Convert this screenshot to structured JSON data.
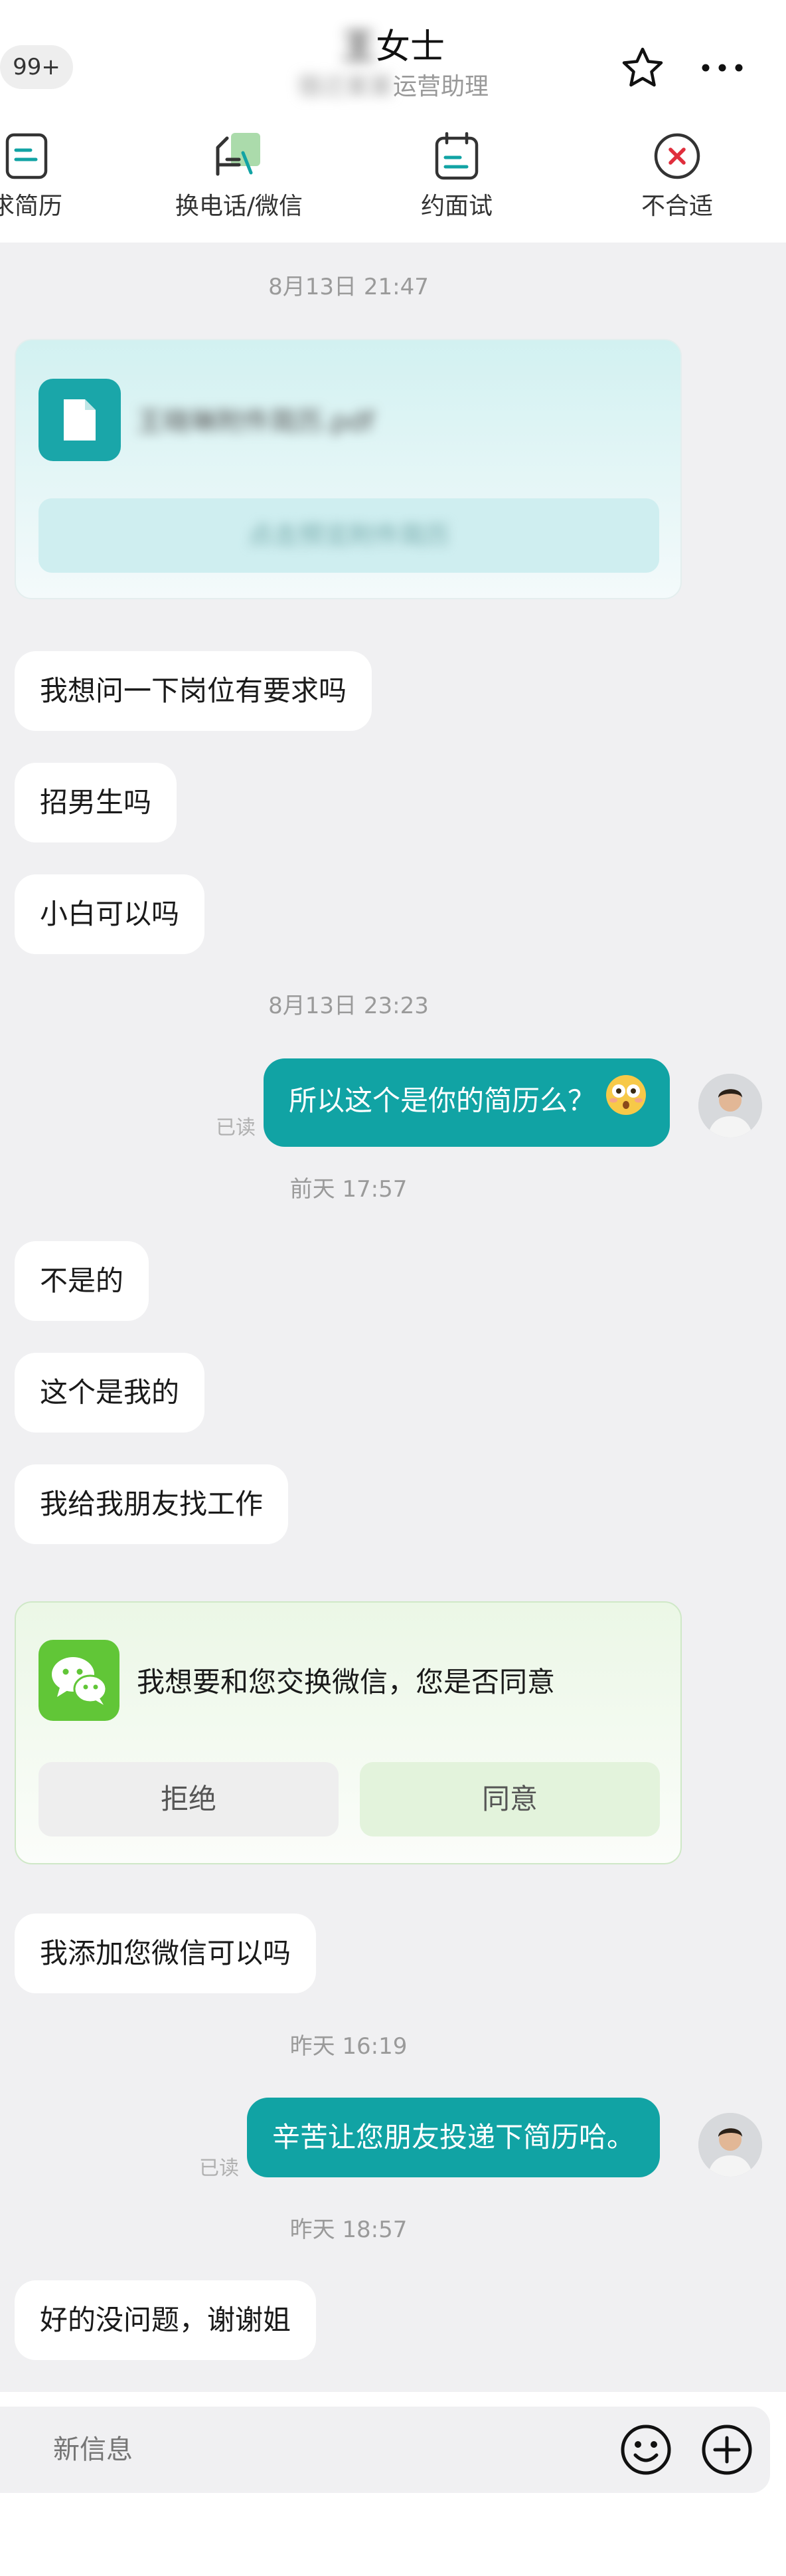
{
  "header": {
    "unread_badge": "99+",
    "title_surname": "王",
    "title_suffix": "女士",
    "subtitle_company": "宿迁某某",
    "subtitle_role": "运营助理"
  },
  "actions": [
    {
      "label": "求简历",
      "icon": "resume-icon"
    },
    {
      "label": "换电话/微信",
      "icon": "exchange-icon"
    },
    {
      "label": "约面试",
      "icon": "calendar-icon"
    },
    {
      "label": "不合适",
      "icon": "reject-icon"
    }
  ],
  "messages": {
    "ts1": "8月13日 21:47",
    "file_card": {
      "filename": "王晓琳附件简历.pdf",
      "button": "点击预览附件简历"
    },
    "m1": "我想问一下岗位有要求吗",
    "m2": "招男生吗",
    "m3": "小白可以吗",
    "ts2": "8月13日 23:23",
    "m4": "所以这个是你的简历么？",
    "read1": "已读",
    "ts3": "前天 17:57",
    "m5": "不是的",
    "m6": "这个是我的",
    "m7": "我给我朋友找工作",
    "wechat_card": {
      "text": "我想要和您交换微信，您是否同意",
      "reject": "拒绝",
      "agree": "同意"
    },
    "m8": "我添加您微信可以吗",
    "ts4": "昨天 16:19",
    "m9": "辛苦让您朋友投递下简历哈。",
    "read2": "已读",
    "ts5": "昨天 18:57",
    "m10": "好的没问题，谢谢姐"
  },
  "input": {
    "placeholder": "新信息"
  },
  "colors": {
    "accent": "#11a3a4",
    "wechat_green": "#61c637",
    "reject_red": "#e02e3c",
    "page_bg": "#f0f0f2"
  }
}
